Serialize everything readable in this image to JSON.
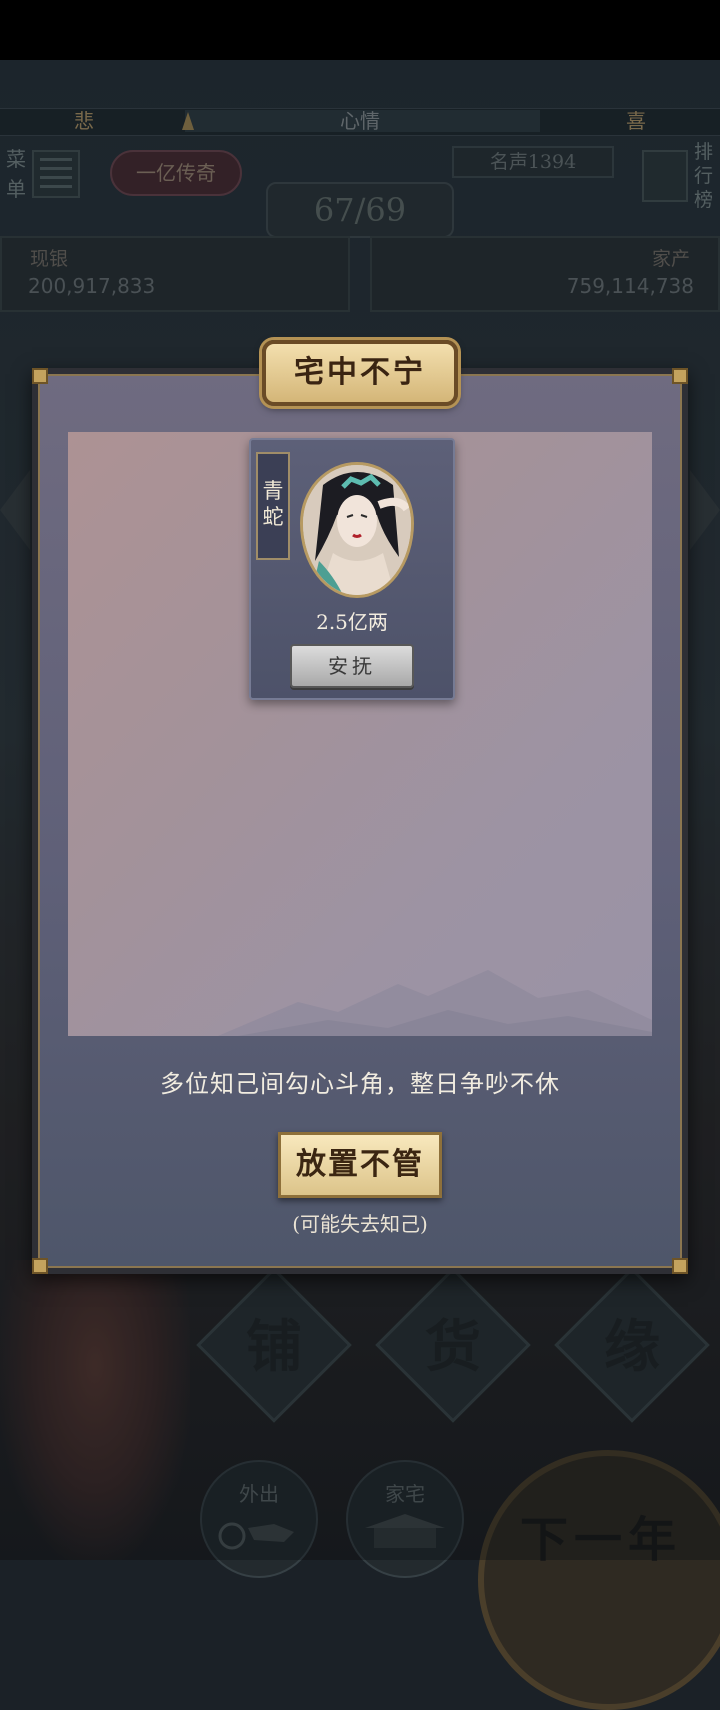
{
  "hud": {
    "mood_label": "心情",
    "mood_sad": "悲",
    "mood_joy": "喜",
    "mood_level": 0.19,
    "menu_label": "菜单",
    "title_badge": "一亿传奇",
    "fame": "名声1394",
    "rank_label": "排行榜",
    "year_progress": "67/69",
    "cash_label": "现银",
    "cash_value": "200,917,833",
    "assets_label": "家产",
    "assets_value": "759,114,738",
    "action_shop": "铺",
    "action_goods": "货",
    "action_fate": "缘",
    "nav_outing": "外出",
    "nav_home": "家宅",
    "next_year": "下一年"
  },
  "dialog": {
    "title": "宅中不宁",
    "character": {
      "name": "青蛇",
      "price": "2.5亿两",
      "soothe_label": "安抚"
    },
    "description": "多位知己间勾心斗角，整日争吵不休",
    "ignore_label": "放置不管",
    "ignore_warning": "(可能失去知己)"
  },
  "colors": {
    "dialog_bg": "#5f6078",
    "title_plate": "#e6cc90",
    "soothe_button": "#c4c4c4",
    "ignore_button": "#ebd7a3"
  },
  "icons": {
    "menu": "menu-list-icon",
    "rank": "leaderboard-icon",
    "outing": "carriage-icon",
    "home": "house-icon"
  }
}
